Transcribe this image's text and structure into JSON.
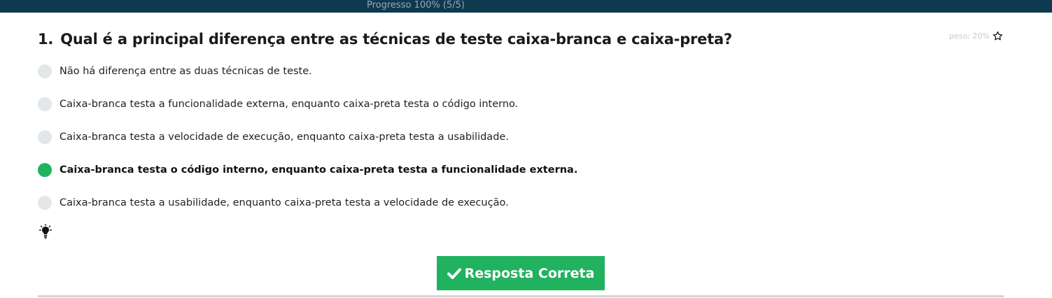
{
  "progress": {
    "label": "Progresso 100% (5/5)"
  },
  "question": {
    "number": "1.",
    "text": "Qual é a principal diferença entre as técnicas de teste caixa-branca e caixa-preta?",
    "weight_label": "peso: 20%"
  },
  "options": [
    {
      "text": "Não há diferença entre as duas técnicas de teste.",
      "correct": false
    },
    {
      "text": "Caixa-branca testa a funcionalidade externa, enquanto caixa-preta testa o código interno.",
      "correct": false
    },
    {
      "text": "Caixa-branca testa a velocidade de execução, enquanto caixa-preta testa a usabilidade.",
      "correct": false
    },
    {
      "text": "Caixa-branca testa o código interno, enquanto caixa-preta testa a funcionalidade externa.",
      "correct": true
    },
    {
      "text": "Caixa-branca testa a usabilidade, enquanto caixa-preta testa a velocidade de execução.",
      "correct": false
    }
  ],
  "answer_button": {
    "label": "Resposta Correta"
  },
  "icons": {
    "favorite": "star-icon",
    "hint": "lightbulb-icon",
    "check": "check-icon"
  },
  "colors": {
    "header_bg": "#0e3a4f",
    "correct": "#21b25f",
    "radio_unselected": "#e4e7e9"
  }
}
